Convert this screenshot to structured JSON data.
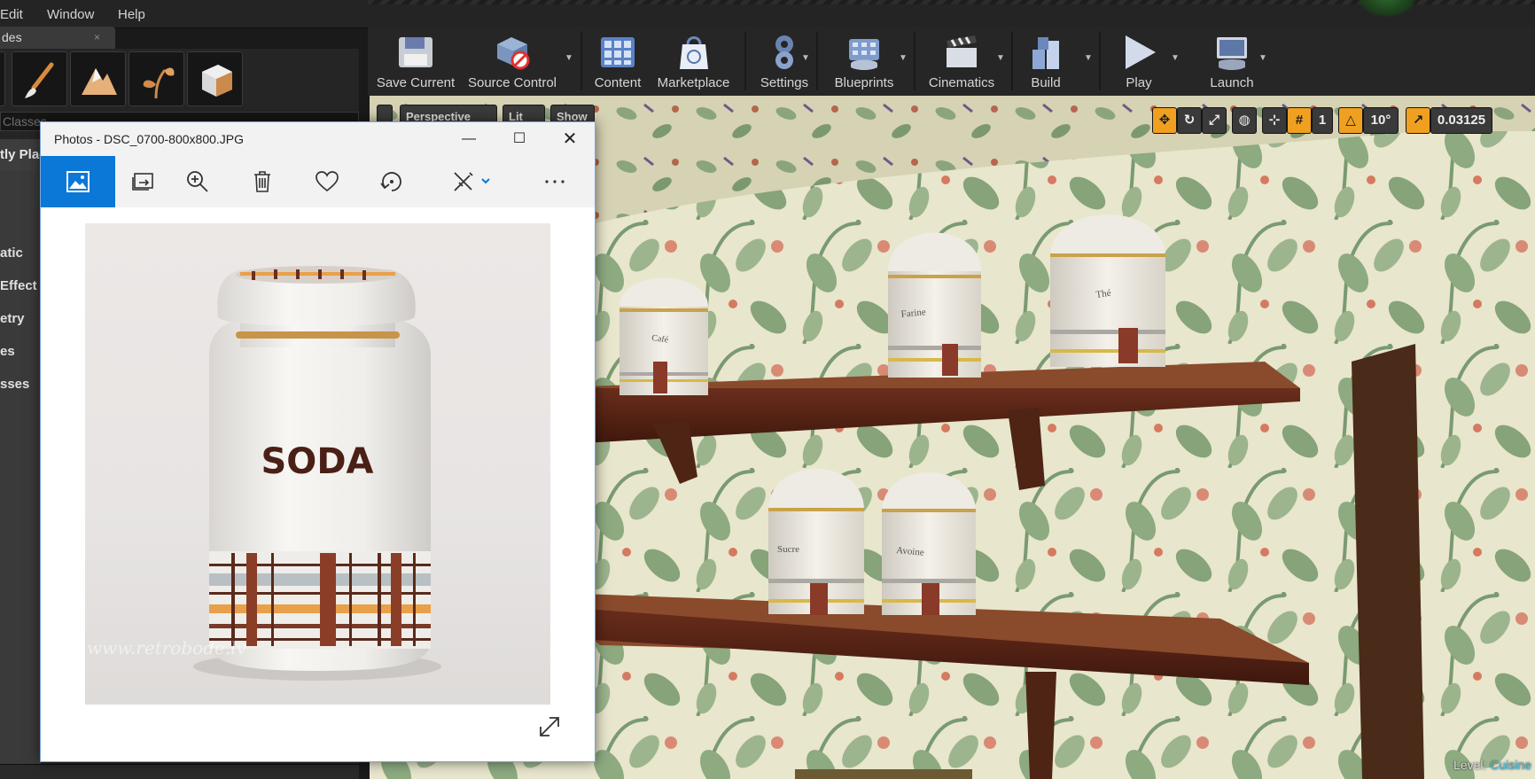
{
  "menu": {
    "items": [
      "Edit",
      "Window",
      "Help"
    ]
  },
  "modes_panel": {
    "tab_label": "des",
    "tab_close": "×",
    "mode_buttons": [
      "paint-mode-icon",
      "landscape-mode-icon",
      "foliage-mode-icon",
      "geometry-mode-icon"
    ],
    "search_placeholder": "Classes",
    "recently_placed": "tly Plac",
    "categories": [
      "atic",
      "Effect",
      "etry",
      "es",
      "sses"
    ]
  },
  "toolbar": {
    "buttons": [
      {
        "label": "Save Current",
        "icon": "save-disk-icon",
        "dropdown": false
      },
      {
        "label": "Source Control",
        "icon": "source-control-icon",
        "dropdown": true
      },
      {
        "label": "Content",
        "icon": "content-grid-icon",
        "dropdown": false
      },
      {
        "label": "Marketplace",
        "icon": "marketplace-bag-icon",
        "dropdown": false
      },
      {
        "label": "Settings",
        "icon": "settings-gear-icon",
        "dropdown": true
      },
      {
        "label": "Blueprints",
        "icon": "blueprints-icon",
        "dropdown": true
      },
      {
        "label": "Cinematics",
        "icon": "clapper-icon",
        "dropdown": true
      },
      {
        "label": "Build",
        "icon": "build-cubes-icon",
        "dropdown": true
      },
      {
        "label": "Play",
        "icon": "play-triangle-icon",
        "dropdown": true
      },
      {
        "label": "Launch",
        "icon": "launch-gamepad-icon",
        "dropdown": true
      }
    ]
  },
  "viewport": {
    "left_chips": [
      "Perspective",
      "Lit",
      "Show"
    ],
    "grid_snap_value": "1",
    "rotation_snap_value": "10°",
    "scale_snap_value": "0.03125",
    "level_label": "Level:",
    "level_name": "Cuisine",
    "canisters_top": [
      "Café",
      "Farine",
      "Thé"
    ],
    "canisters_bottom": [
      "Sucre",
      "Avoine"
    ]
  },
  "photos_window": {
    "title": "Photos - DSC_0700-800x800.JPG",
    "toolbar_icons": [
      "view-image-icon",
      "slideshow-icon",
      "zoom-icon",
      "delete-icon",
      "favorite-heart-icon",
      "rotate-icon",
      "edit-create-icon",
      "more-icon"
    ],
    "jar_label": "SODA",
    "watermark": "www.retrobode.lv",
    "expand_icon": "expand-icon"
  },
  "colors": {
    "accent_blue": "#0b78d7",
    "orange_tool": "#f0a020",
    "level_name": "#48c4e8"
  }
}
